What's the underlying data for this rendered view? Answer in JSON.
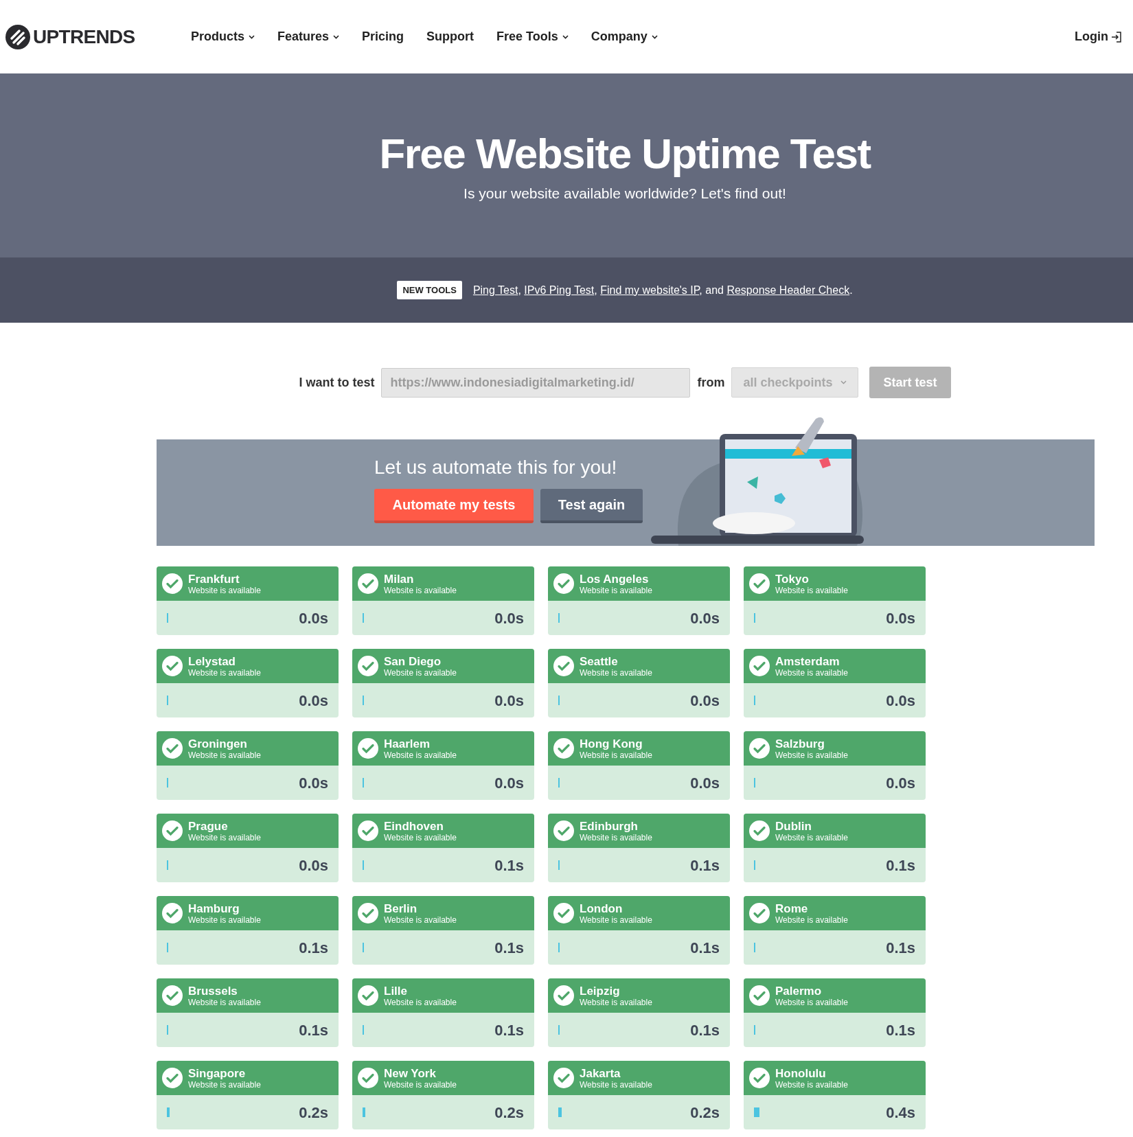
{
  "header": {
    "logo": "UPTRENDS",
    "nav": [
      {
        "label": "Products",
        "dropdown": true
      },
      {
        "label": "Features",
        "dropdown": true
      },
      {
        "label": "Pricing",
        "dropdown": false
      },
      {
        "label": "Support",
        "dropdown": false
      },
      {
        "label": "Free Tools",
        "dropdown": true
      },
      {
        "label": "Company",
        "dropdown": true
      }
    ],
    "login": "Login"
  },
  "hero": {
    "title": "Free Website Uptime Test",
    "subtitle": "Is your website available worldwide? Let's find out!"
  },
  "new_tools": {
    "badge": "NEW TOOLS",
    "parts": [
      {
        "kind": "link",
        "text": "Ping Test"
      },
      {
        "kind": "text",
        "text": ", "
      },
      {
        "kind": "link",
        "text": "IPv6 Ping Test"
      },
      {
        "kind": "text",
        "text": ", "
      },
      {
        "kind": "link",
        "text": "Find my website's IP"
      },
      {
        "kind": "text",
        "text": ", and "
      },
      {
        "kind": "link",
        "text": "Response Header Check"
      },
      {
        "kind": "text",
        "text": "."
      }
    ]
  },
  "form": {
    "label": "I want to test",
    "url": "https://www.indonesiadigitalmarketing.id/",
    "from_label": "from",
    "checkpoints": "all checkpoints",
    "start": "Start test",
    "start_disabled": true
  },
  "banner": {
    "heading": "Let us automate this for you!",
    "primary": "Automate my tests",
    "secondary": "Test again"
  },
  "results": [
    {
      "city": "Frankfurt",
      "status": "Website is available",
      "time": "0.0s",
      "level": 0.005
    },
    {
      "city": "Milan",
      "status": "Website is available",
      "time": "0.0s",
      "level": 0.005
    },
    {
      "city": "Los Angeles",
      "status": "Website is available",
      "time": "0.0s",
      "level": 0.005
    },
    {
      "city": "Tokyo",
      "status": "Website is available",
      "time": "0.0s",
      "level": 0.005
    },
    {
      "city": "Lelystad",
      "status": "Website is available",
      "time": "0.0s",
      "level": 0.005
    },
    {
      "city": "San Diego",
      "status": "Website is available",
      "time": "0.0s",
      "level": 0.005
    },
    {
      "city": "Seattle",
      "status": "Website is available",
      "time": "0.0s",
      "level": 0.005
    },
    {
      "city": "Amsterdam",
      "status": "Website is available",
      "time": "0.0s",
      "level": 0.005
    },
    {
      "city": "Groningen",
      "status": "Website is available",
      "time": "0.0s",
      "level": 0.005
    },
    {
      "city": "Haarlem",
      "status": "Website is available",
      "time": "0.0s",
      "level": 0.005
    },
    {
      "city": "Hong Kong",
      "status": "Website is available",
      "time": "0.0s",
      "level": 0.005
    },
    {
      "city": "Salzburg",
      "status": "Website is available",
      "time": "0.0s",
      "level": 0.005
    },
    {
      "city": "Prague",
      "status": "Website is available",
      "time": "0.0s",
      "level": 0.005
    },
    {
      "city": "Eindhoven",
      "status": "Website is available",
      "time": "0.1s",
      "level": 0.005
    },
    {
      "city": "Edinburgh",
      "status": "Website is available",
      "time": "0.1s",
      "level": 0.005
    },
    {
      "city": "Dublin",
      "status": "Website is available",
      "time": "0.1s",
      "level": 0.005
    },
    {
      "city": "Hamburg",
      "status": "Website is available",
      "time": "0.1s",
      "level": 0.005
    },
    {
      "city": "Berlin",
      "status": "Website is available",
      "time": "0.1s",
      "level": 0.01
    },
    {
      "city": "London",
      "status": "Website is available",
      "time": "0.1s",
      "level": 0.01
    },
    {
      "city": "Rome",
      "status": "Website is available",
      "time": "0.1s",
      "level": 0.005
    },
    {
      "city": "Brussels",
      "status": "Website is available",
      "time": "0.1s",
      "level": 0.01
    },
    {
      "city": "Lille",
      "status": "Website is available",
      "time": "0.1s",
      "level": 0.01
    },
    {
      "city": "Leipzig",
      "status": "Website is available",
      "time": "0.1s",
      "level": 0.01
    },
    {
      "city": "Palermo",
      "status": "Website is available",
      "time": "0.1s",
      "level": 0.015
    },
    {
      "city": "Singapore",
      "status": "Website is available",
      "time": "0.2s",
      "level": 0.025
    },
    {
      "city": "New York",
      "status": "Website is available",
      "time": "0.2s",
      "level": 0.025
    },
    {
      "city": "Jakarta",
      "status": "Website is available",
      "time": "0.2s",
      "level": 0.03
    },
    {
      "city": "Honolulu",
      "status": "Website is available",
      "time": "0.4s",
      "level": 0.05
    }
  ]
}
